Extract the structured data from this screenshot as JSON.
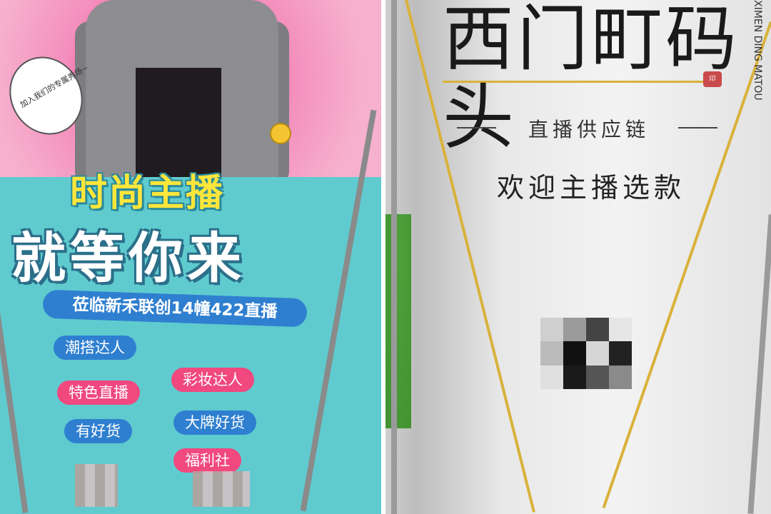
{
  "left_poster": {
    "bubble_text": "加入我们的专属秀场~",
    "headline_top": "时尚主播",
    "headline_main": "就等你来",
    "location": "莅临新禾联创14幢422直播",
    "tags": [
      "潮搭达人",
      "彩妆达人",
      "特色直播",
      "大牌好货",
      "有好货",
      "福利社"
    ]
  },
  "right_banner": {
    "logo_cn": "西门町码头",
    "logo_en": "XIMEN DING MATOU",
    "subtitle": "直播供应链",
    "welcome": "欢迎主播选款"
  },
  "colors": {
    "poster_pink": "#f57ab0",
    "poster_teal": "#5fcbcf",
    "tag_blue": "#2f7fd0",
    "tag_pink": "#f0487f",
    "headline_yellow": "#ffe63b",
    "banner_gold": "#d9b23a"
  }
}
